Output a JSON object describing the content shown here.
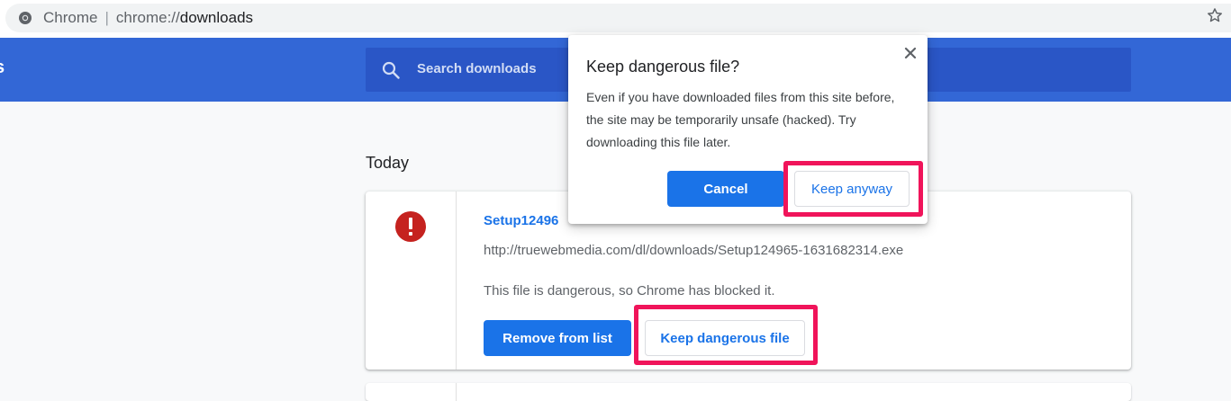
{
  "omnibox": {
    "site_label": "Chrome",
    "separator": "|",
    "url_scheme": "chrome://",
    "url_host": "downloads"
  },
  "header": {
    "title_partial": "s",
    "search_placeholder": "Search downloads"
  },
  "main": {
    "date_heading": "Today",
    "download": {
      "file_name": "Setup124965-1631682314.exe",
      "file_name_visible": "Setup12496",
      "url": "http://truewebmedia.com/dl/downloads/Setup124965-1631682314.exe",
      "status": "This file is dangerous, so Chrome has blocked it.",
      "remove_label": "Remove from list",
      "keep_label": "Keep dangerous file"
    }
  },
  "dialog": {
    "title": "Keep dangerous file?",
    "body": "Even if you have downloaded files from this site before, the site may be temporarily unsafe (hacked). Try downloading this file later.",
    "cancel_label": "Cancel",
    "keep_label": "Keep anyway"
  },
  "colors": {
    "header_blue": "#3367d6",
    "accent_blue": "#1a73e8",
    "danger_red": "#c5221f",
    "highlight_pink": "#f0145a"
  }
}
